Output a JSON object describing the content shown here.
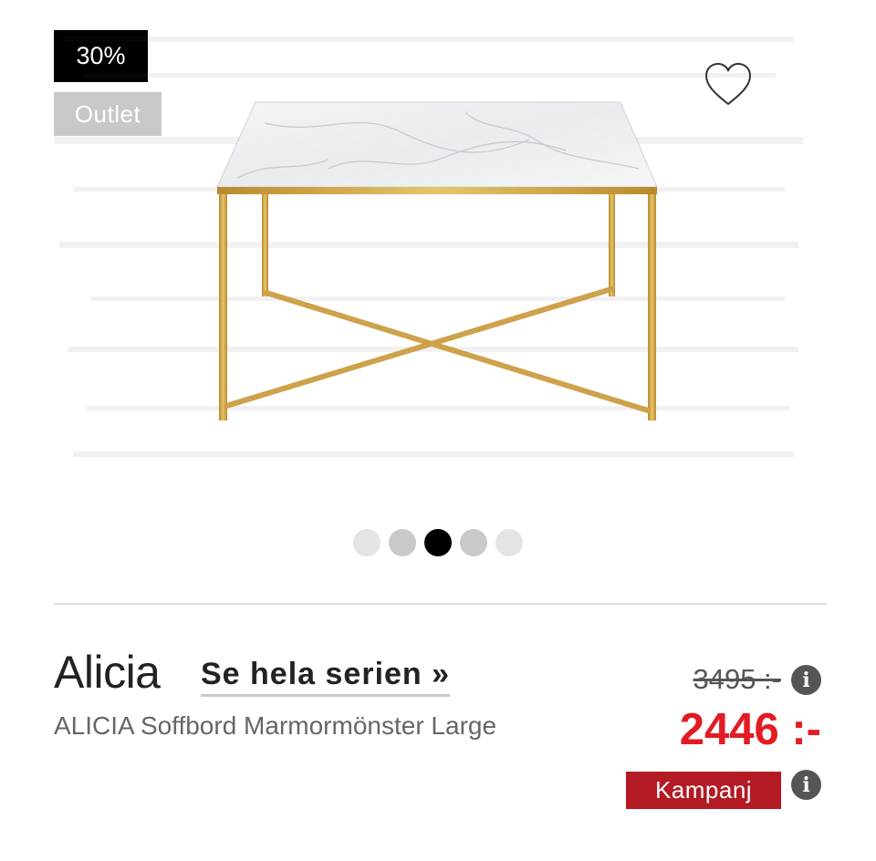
{
  "badges": {
    "discount": "30%",
    "outlet": "Outlet"
  },
  "icons": {
    "favorite": "heart-outline-icon",
    "info": "info-icon"
  },
  "gallery": {
    "dot_colors": [
      "#e4e4e4",
      "#c9c9c9",
      "#000000",
      "#c9c9c9",
      "#e4e4e4"
    ],
    "active_index": 2
  },
  "product": {
    "series": "Alicia",
    "series_link": "Se hela serien »",
    "name": "ALICIA Soffbord Marmormönster Large"
  },
  "price": {
    "old": "3495 :-",
    "new": "2446 :-",
    "campaign": "Kampanj"
  },
  "colors": {
    "sale_red": "#e31b23",
    "campaign_bg": "#b31a23",
    "brass": "#d9b04f"
  }
}
